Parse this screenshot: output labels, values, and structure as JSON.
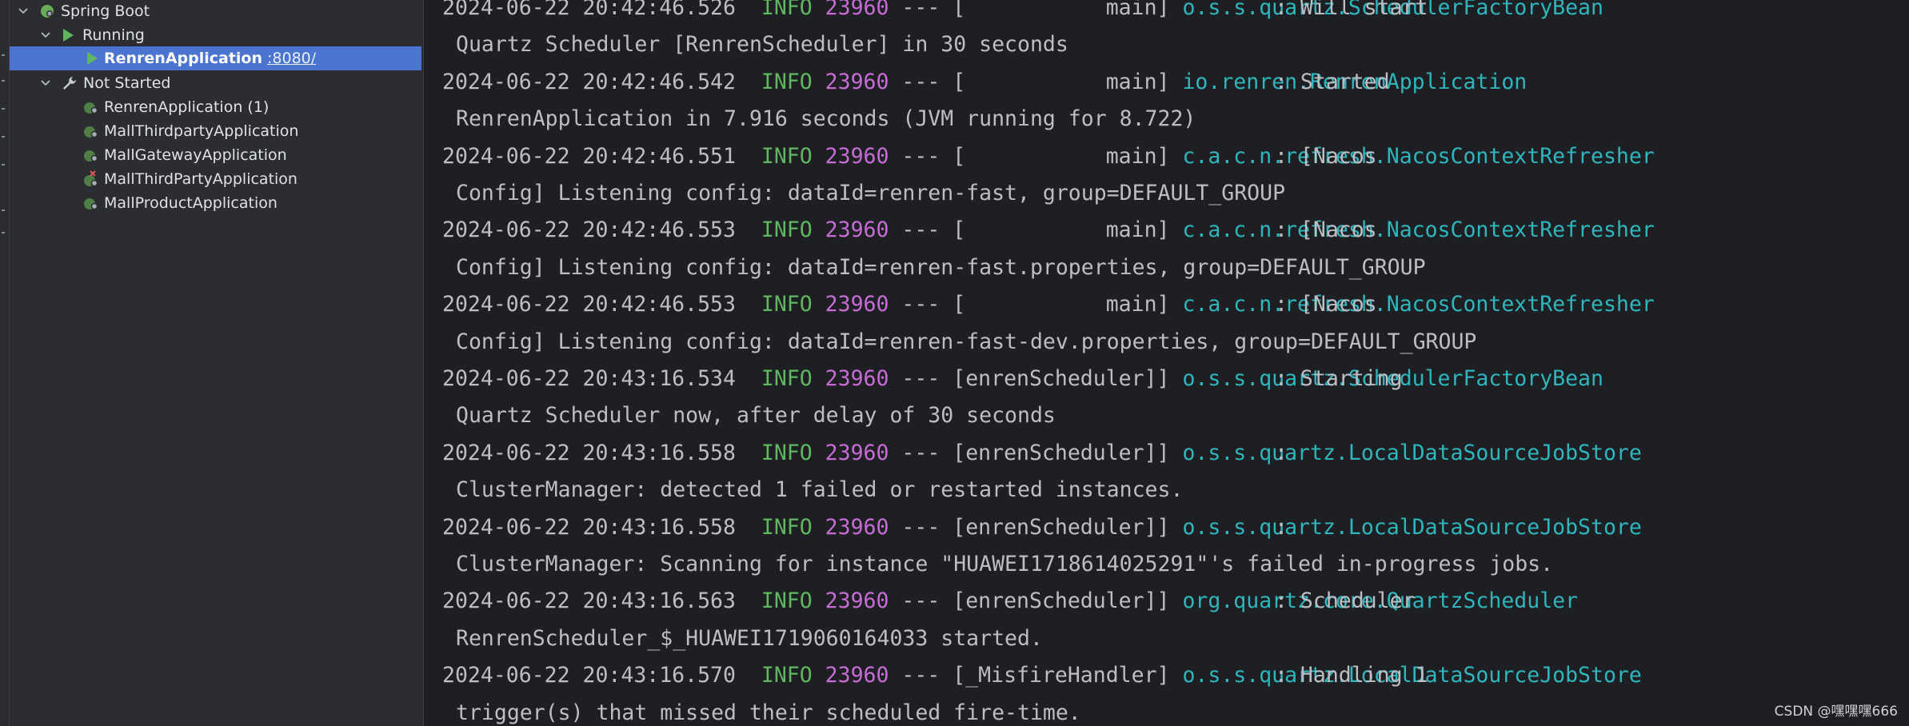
{
  "services": {
    "spring_boot": {
      "label": "Spring Boot"
    },
    "running": {
      "label": "Running"
    },
    "running_app": {
      "name": "RenrenApplication",
      "port": ":8080/"
    },
    "not_started": {
      "label": "Not Started"
    },
    "apps": [
      {
        "name": "RenrenApplication (1)",
        "icon": "spring-boot-icon"
      },
      {
        "name": "MallThirdpartyApplication",
        "icon": "spring-boot-icon"
      },
      {
        "name": "MallGatewayApplication",
        "icon": "spring-boot-icon"
      },
      {
        "name": "MallThirdPartyApplication",
        "icon": "spring-boot-error-icon"
      },
      {
        "name": "MallProductApplication",
        "icon": "spring-boot-icon"
      }
    ]
  },
  "console": {
    "entries": [
      {
        "ts": "2024-06-22 20:42:46.526",
        "level": "INFO",
        "pid": "23960",
        "sep": "---",
        "thread": "[           main]",
        "logger": "o.s.s.quartz.SchedulerFactoryBean",
        "msg": ": Will start",
        "cont": "Quartz Scheduler [RenrenScheduler] in 30 seconds"
      },
      {
        "ts": "2024-06-22 20:42:46.542",
        "level": "INFO",
        "pid": "23960",
        "sep": "---",
        "thread": "[           main]",
        "logger": "io.renren.RenrenApplication",
        "msg": ": Started",
        "cont": "RenrenApplication in 7.916 seconds (JVM running for 8.722)"
      },
      {
        "ts": "2024-06-22 20:42:46.551",
        "level": "INFO",
        "pid": "23960",
        "sep": "---",
        "thread": "[           main]",
        "logger": "c.a.c.n.refresh.NacosContextRefresher",
        "msg": ": [Nacos",
        "cont": "Config] Listening config: dataId=renren-fast, group=DEFAULT_GROUP"
      },
      {
        "ts": "2024-06-22 20:42:46.553",
        "level": "INFO",
        "pid": "23960",
        "sep": "---",
        "thread": "[           main]",
        "logger": "c.a.c.n.refresh.NacosContextRefresher",
        "msg": ": [Nacos",
        "cont": "Config] Listening config: dataId=renren-fast.properties, group=DEFAULT_GROUP"
      },
      {
        "ts": "2024-06-22 20:42:46.553",
        "level": "INFO",
        "pid": "23960",
        "sep": "---",
        "thread": "[           main]",
        "logger": "c.a.c.n.refresh.NacosContextRefresher",
        "msg": ": [Nacos",
        "cont": "Config] Listening config: dataId=renren-fast-dev.properties, group=DEFAULT_GROUP"
      },
      {
        "ts": "2024-06-22 20:43:16.534",
        "level": "INFO",
        "pid": "23960",
        "sep": "---",
        "thread": "[enrenScheduler]]",
        "logger": "o.s.s.quartz.SchedulerFactoryBean",
        "msg": ": Starting",
        "cont": "Quartz Scheduler now, after delay of 30 seconds"
      },
      {
        "ts": "2024-06-22 20:43:16.558",
        "level": "INFO",
        "pid": "23960",
        "sep": "---",
        "thread": "[enrenScheduler]]",
        "logger": "o.s.s.quartz.LocalDataSourceJobStore",
        "msg": ":",
        "cont": "ClusterManager: detected 1 failed or restarted instances."
      },
      {
        "ts": "2024-06-22 20:43:16.558",
        "level": "INFO",
        "pid": "23960",
        "sep": "---",
        "thread": "[enrenScheduler]]",
        "logger": "o.s.s.quartz.LocalDataSourceJobStore",
        "msg": ":",
        "cont": "ClusterManager: Scanning for instance \"HUAWEI1718614025291\"'s failed in-progress jobs."
      },
      {
        "ts": "2024-06-22 20:43:16.563",
        "level": "INFO",
        "pid": "23960",
        "sep": "---",
        "thread": "[enrenScheduler]]",
        "logger": "org.quartz.core.QuartzScheduler",
        "msg": ": Scheduler",
        "cont": "RenrenScheduler_$_HUAWEI1719060164033 started."
      },
      {
        "ts": "2024-06-22 20:43:16.570",
        "level": "INFO",
        "pid": "23960",
        "sep": "---",
        "thread": "[_MisfireHandler]",
        "logger": "o.s.s.quartz.LocalDataSourceJobStore",
        "msg": ": Handling 1",
        "cont": "trigger(s) that missed their scheduled fire-time."
      }
    ]
  },
  "watermark": "CSDN @嘿嘿嘿666",
  "colors": {
    "info": "#5fb85f",
    "pid": "#c76bd6",
    "logger": "#2fb5bd",
    "selection": "#4a74cf"
  }
}
